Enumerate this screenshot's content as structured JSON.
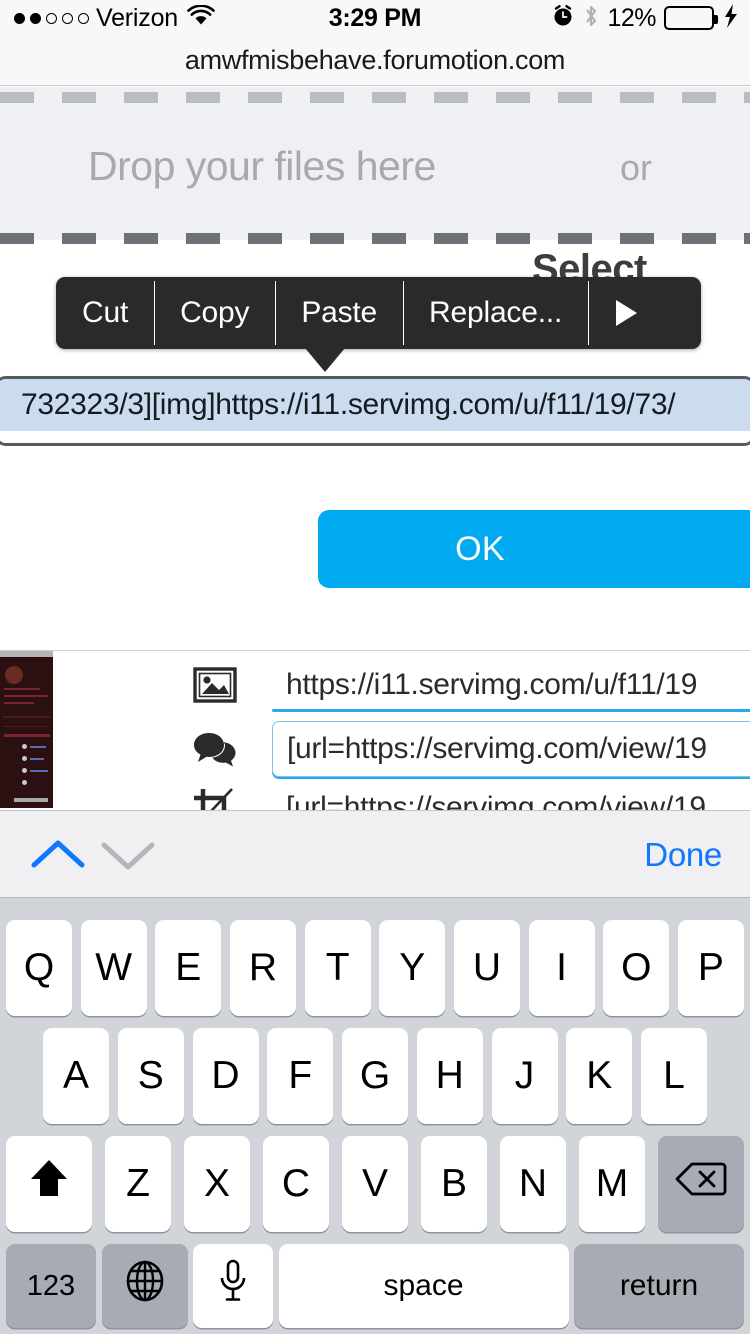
{
  "status_bar": {
    "carrier": "Verizon",
    "signal_dots_filled": 2,
    "signal_dots_total": 5,
    "time": "3:29 PM",
    "battery_percent": "12%",
    "battery_level": 22,
    "battery_color": "#ff2d20",
    "icons": [
      "wifi-icon",
      "alarm-icon",
      "bluetooth-icon",
      "battery-icon",
      "charging-bolt-icon"
    ]
  },
  "browser": {
    "url": "amwfmisbehave.forumotion.com"
  },
  "page": {
    "drop_zone": {
      "label": "Drop your files here",
      "or_label": "or"
    },
    "ghost_text": "Select",
    "selected_input": {
      "value": "732323/3][img]https://i11.servimg.com/u/f11/19/73/",
      "selection_color": "#cadced"
    },
    "ok_button": {
      "label": "OK",
      "color": "#00aaf0"
    },
    "form_rows": [
      {
        "icon": "image-icon",
        "value": "https://i11.servimg.com/u/f11/19"
      },
      {
        "icon": "speech-bubble-icon",
        "value": "[url=https://servimg.com/view/19"
      },
      {
        "icon": "crop-icon",
        "value": "[url=https://servimg.com/view/19"
      }
    ]
  },
  "edit_menu": {
    "items": [
      {
        "label": "Cut"
      },
      {
        "label": "Copy"
      },
      {
        "label": "Paste"
      },
      {
        "label": "Replace..."
      }
    ],
    "more_icon": "triangle-right-icon",
    "background": "#2a2a2a"
  },
  "accessory_bar": {
    "prev_icon": "chevron-up-icon",
    "next_icon": "chevron-down-icon",
    "prev_enabled_color": "#1078ff",
    "next_disabled_color": "#b4b6ba",
    "done_label": "Done",
    "done_color": "#1078ff"
  },
  "keyboard": {
    "row1": [
      "Q",
      "W",
      "E",
      "R",
      "T",
      "Y",
      "U",
      "I",
      "O",
      "P"
    ],
    "row2": [
      "A",
      "S",
      "D",
      "F",
      "G",
      "H",
      "J",
      "K",
      "L"
    ],
    "row3_letters": [
      "Z",
      "X",
      "C",
      "V",
      "B",
      "N",
      "M"
    ],
    "shift_icon": "shift-icon",
    "backspace_icon": "backspace-icon",
    "numbers_label": "123",
    "globe_icon": "globe-icon",
    "mic_icon": "microphone-icon",
    "space_label": "space",
    "return_label": "return",
    "background": "#d1d4d9",
    "shift_active": true
  }
}
